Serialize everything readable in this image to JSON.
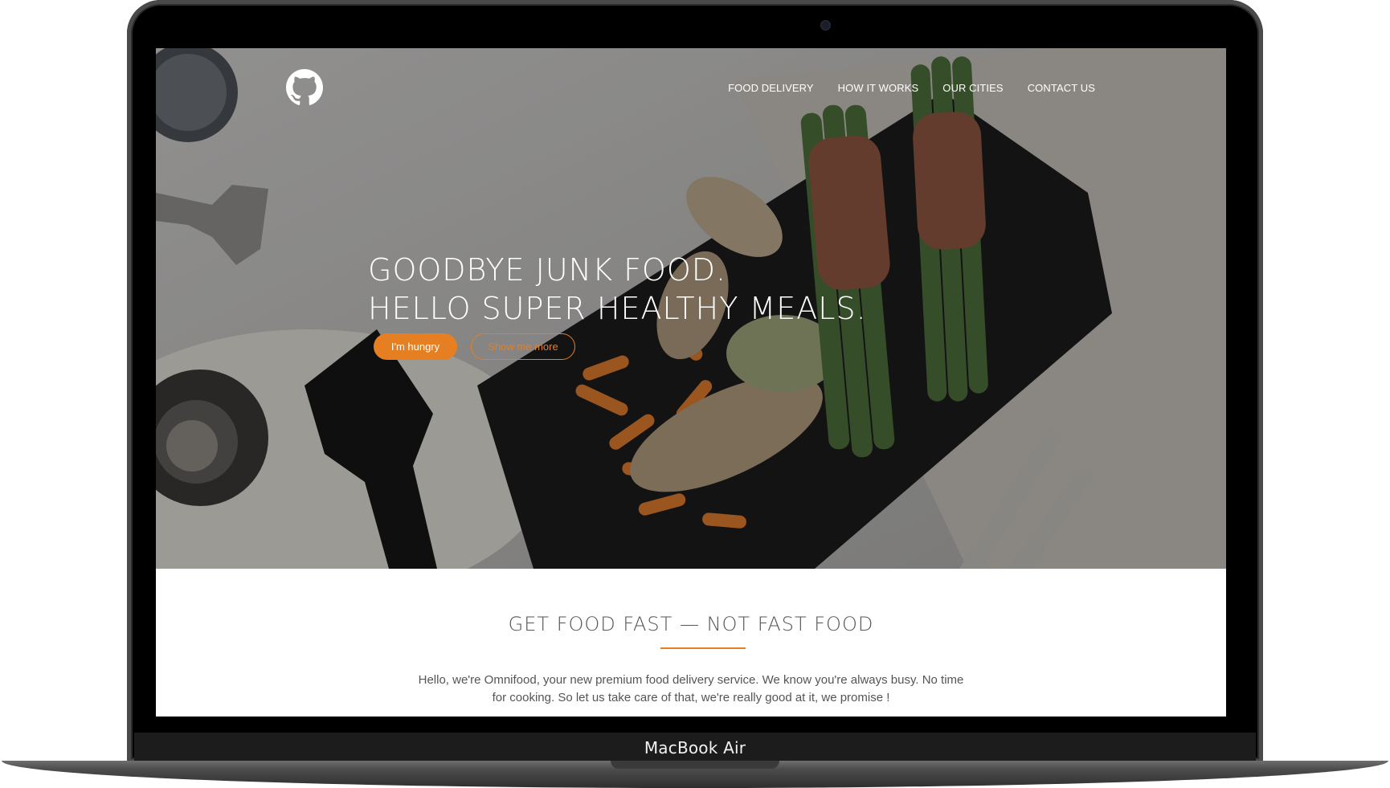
{
  "device": {
    "label": "MacBook Air"
  },
  "header": {
    "logo_icon": "github-icon",
    "nav": [
      {
        "label": "FOOD DELIVERY"
      },
      {
        "label": "HOW IT WORKS"
      },
      {
        "label": "OUR CITIES"
      },
      {
        "label": "CONTACT US"
      }
    ]
  },
  "hero": {
    "line1": "GOODBYE JUNK FOOD.",
    "line2": "HELLO SUPER HEALTHY MEALS.",
    "primary_button": "I'm hungry",
    "secondary_button": "Show me more"
  },
  "section": {
    "title": "GET FOOD FAST — NOT FAST FOOD",
    "text": "Hello, we're Omnifood, your new premium food delivery service. We know you're always busy. No time for cooking. So let us take care of that, we're really good at it, we promise !"
  },
  "colors": {
    "accent": "#e67e22",
    "text": "#555555"
  }
}
